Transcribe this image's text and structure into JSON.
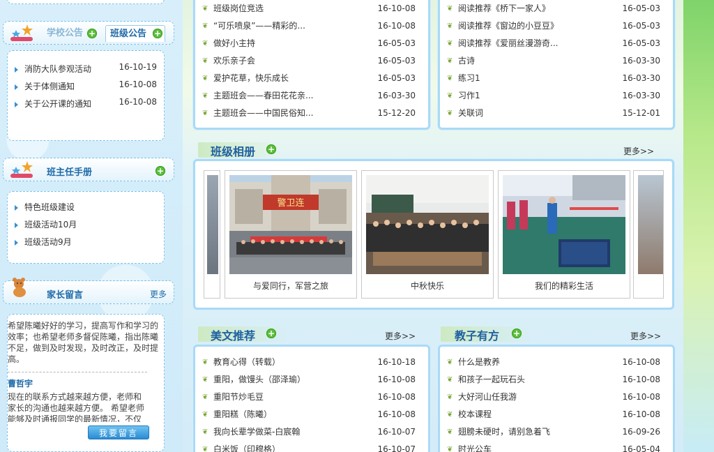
{
  "left": {
    "notice": {
      "tab_school": "学校公告",
      "tab_class": "班级公告",
      "items": [
        {
          "title": "消防大队参观活动",
          "date": "16-10-19"
        },
        {
          "title": "关于体侧通知",
          "date": "16-10-08"
        },
        {
          "title": "关于公开课的通知",
          "date": "16-10-08"
        }
      ]
    },
    "handbook": {
      "title": "班主任手册",
      "items": [
        "特色班级建设",
        "班级活动10月",
        "班级活动9月"
      ]
    },
    "messages": {
      "title": "家长留言",
      "more": "更多",
      "msg1": "希望陈曦好好的学习，提高写作和学习的效率；也希望老师多督促陈曦，指出陈曦不足，做到及时发现，及时改正，及时提高。",
      "name": "曹哲宇",
      "msg2": "现在的联系方式越来越方便，老师和家长的沟通也越来越方便。 希望老师能够及时通报同学的最新情况，不仅仅是",
      "button": "我要留言"
    }
  },
  "top_left_list": [
    {
      "title": "班级岗位竞选",
      "date": "16-10-08"
    },
    {
      "title": "“可乐喷泉”——精彩的...",
      "date": "16-10-08"
    },
    {
      "title": "做好小主持",
      "date": "16-05-03"
    },
    {
      "title": "欢乐亲子会",
      "date": "16-05-03"
    },
    {
      "title": "爱护花草，快乐成长",
      "date": "16-05-03"
    },
    {
      "title": "主题班会——春田花花亲...",
      "date": "16-03-30"
    },
    {
      "title": "主题班会——中国民俗知...",
      "date": "15-12-20"
    }
  ],
  "top_right_list": [
    {
      "title": "阅读推荐《桥下一家人》",
      "date": "16-05-03"
    },
    {
      "title": "阅读推荐《窗边的小豆豆》",
      "date": "16-05-03"
    },
    {
      "title": "阅读推荐《爱丽丝漫游奇...",
      "date": "16-05-03"
    },
    {
      "title": "古诗",
      "date": "16-03-30"
    },
    {
      "title": "练习1",
      "date": "16-03-30"
    },
    {
      "title": "习作1",
      "date": "16-03-30"
    },
    {
      "title": "关联词",
      "date": "15-12-01"
    }
  ],
  "album": {
    "title": "班级相册",
    "more": "更多>>",
    "photos": [
      {
        "caption": "与爱同行，军营之旅",
        "banner": "警卫连"
      },
      {
        "caption": "中秋快乐"
      },
      {
        "caption": "我们的精彩生活"
      }
    ]
  },
  "essays": {
    "title": "美文推荐",
    "more": "更多>>",
    "items": [
      {
        "title": "教育心得（转载）",
        "date": "16-10-18"
      },
      {
        "title": "重阳，做馒头（邵泽瑜）",
        "date": "16-10-08"
      },
      {
        "title": "重阳节炒毛豆",
        "date": "16-10-08"
      },
      {
        "title": "重阳糕（陈曦）",
        "date": "16-10-08"
      },
      {
        "title": "我向长辈学做菜-白宸翰",
        "date": "16-10-07"
      },
      {
        "title": "白米饭（印穆格）",
        "date": "16-10-07"
      }
    ]
  },
  "teaching": {
    "title": "教子有方",
    "more": "更多>>",
    "items": [
      {
        "title": "什么是教养",
        "date": "16-10-08"
      },
      {
        "title": "和孩子一起玩石头",
        "date": "16-10-08"
      },
      {
        "title": "大好河山任我游",
        "date": "16-10-08"
      },
      {
        "title": "校本课程",
        "date": "16-10-08"
      },
      {
        "title": "翅膀未硬时，请别急着飞",
        "date": "16-09-26"
      },
      {
        "title": "时光公车",
        "date": "16-05-04"
      }
    ]
  },
  "colors": {
    "accent": "#1e6aa8",
    "border": "#a9daf6",
    "green_plus": "#5cbf3a"
  }
}
